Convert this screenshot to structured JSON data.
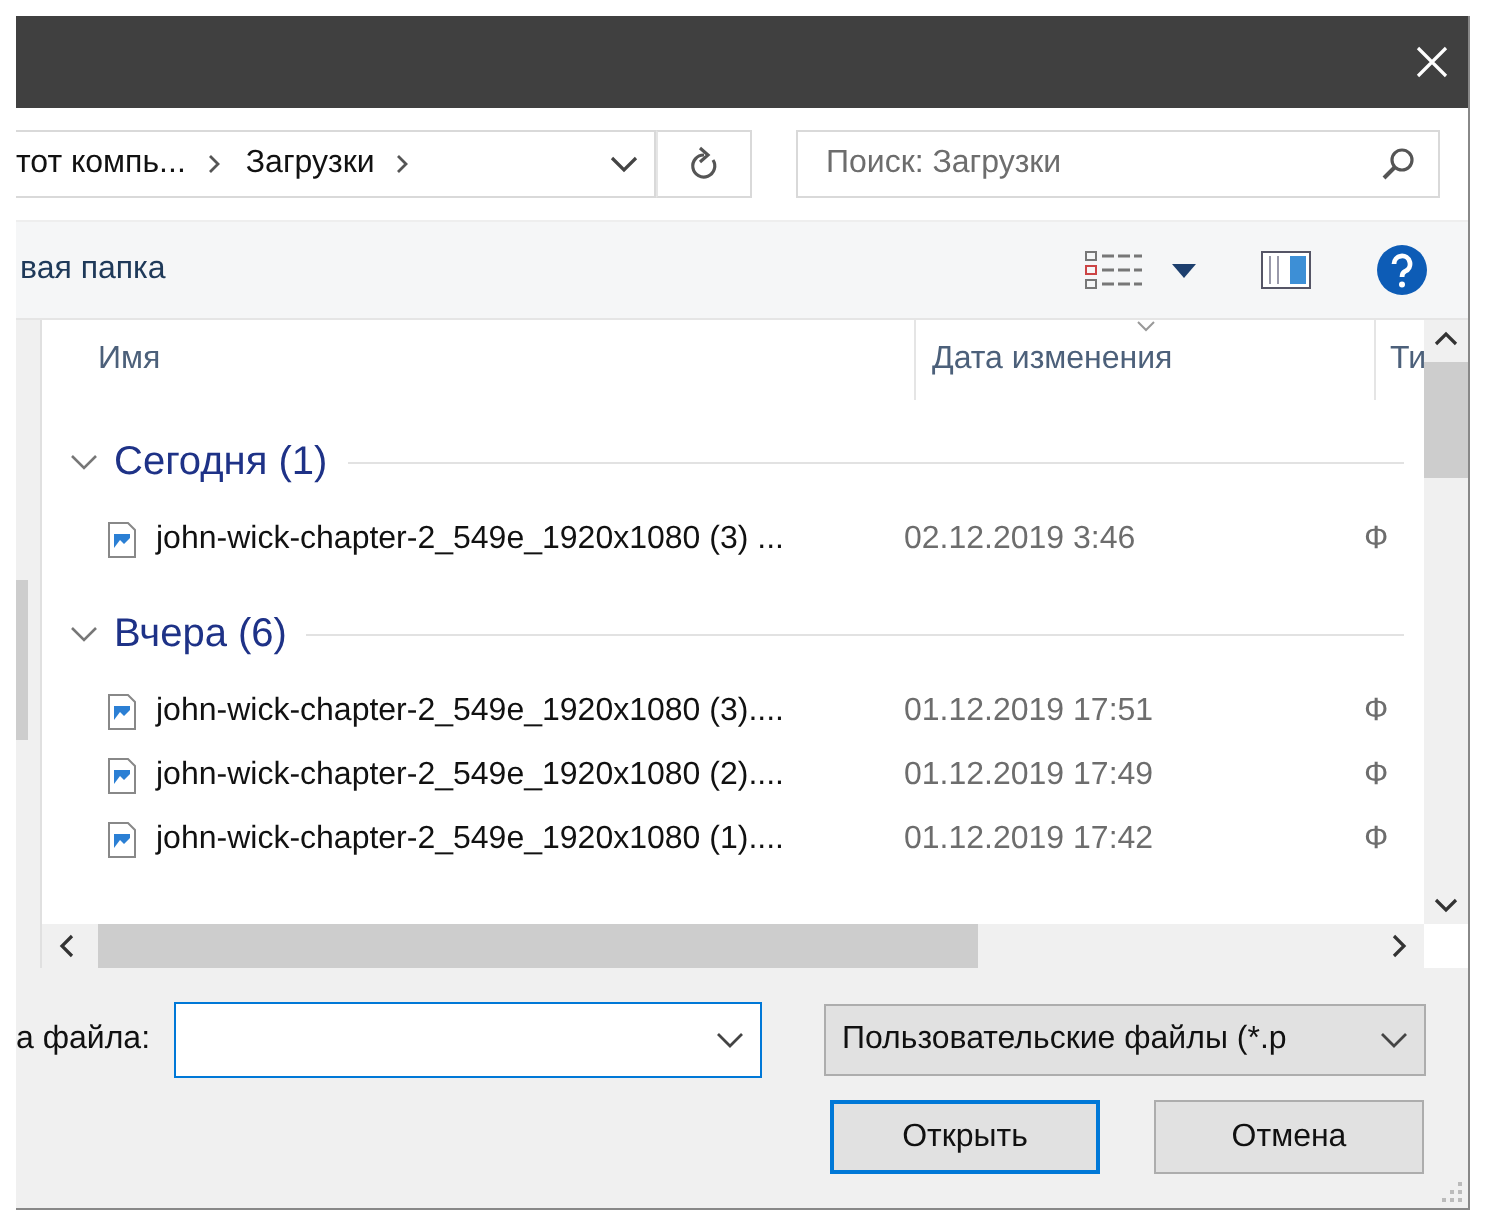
{
  "address": {
    "crumbs": [
      "тот компь...",
      "Загрузки"
    ]
  },
  "search": {
    "placeholder": "Поиск: Загрузки"
  },
  "toolbar": {
    "new_folder": "вая папка"
  },
  "columns": [
    {
      "label": "Имя",
      "sorted": false
    },
    {
      "label": "Дата изменения",
      "sorted": true
    },
    {
      "label": "Ти",
      "sorted": false
    }
  ],
  "groups": [
    {
      "title": "Сегодня (1)",
      "expanded": true,
      "files": [
        {
          "name": "john-wick-chapter-2_549e_1920x1080 (3) ...",
          "date": "02.12.2019 3:46",
          "type": "Ф"
        }
      ]
    },
    {
      "title": "Вчера (6)",
      "expanded": true,
      "files": [
        {
          "name": "john-wick-chapter-2_549e_1920x1080 (3)....",
          "date": "01.12.2019 17:51",
          "type": "Ф"
        },
        {
          "name": "john-wick-chapter-2_549e_1920x1080 (2)....",
          "date": "01.12.2019 17:49",
          "type": "Ф"
        },
        {
          "name": "john-wick-chapter-2_549e_1920x1080 (1)....",
          "date": "01.12.2019 17:42",
          "type": "Ф"
        }
      ]
    }
  ],
  "file_name": {
    "label": "а файла:",
    "focused": true
  },
  "file_type": {
    "value": "Пользовательские файлы (*.p"
  },
  "buttons": [
    {
      "label": "Открыть",
      "default": true
    },
    {
      "label": "Отмена",
      "default": false
    }
  ]
}
